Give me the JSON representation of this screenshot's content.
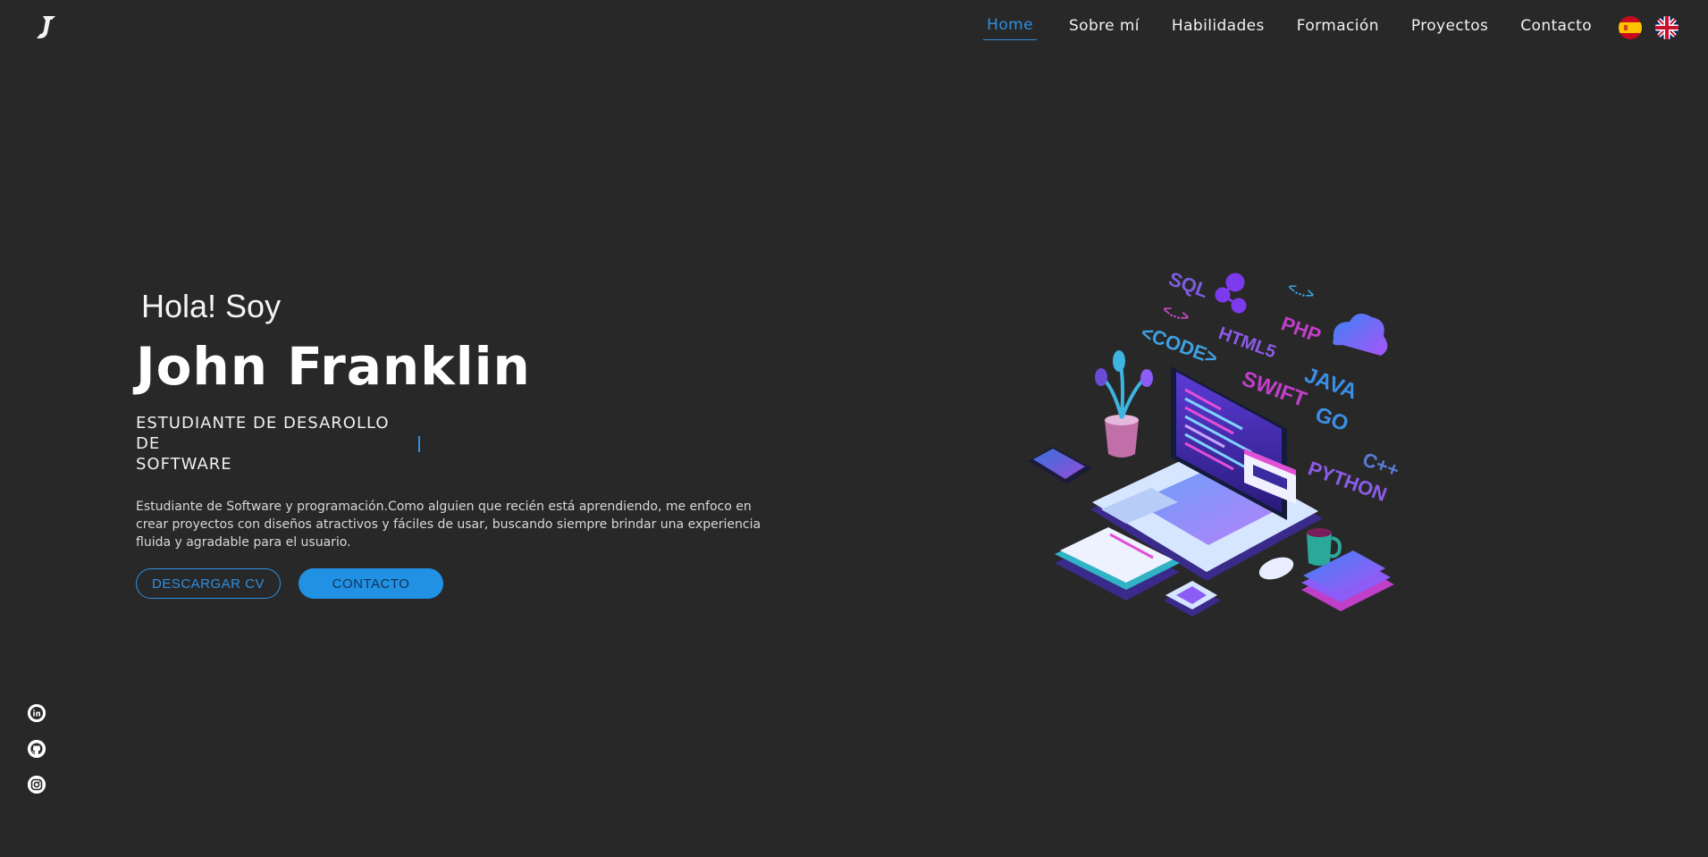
{
  "logo": {
    "letter": "J"
  },
  "nav": {
    "items": [
      {
        "label": "Home",
        "active": true
      },
      {
        "label": "Sobre mí"
      },
      {
        "label": "Habilidades"
      },
      {
        "label": "Formación"
      },
      {
        "label": "Proyectos"
      },
      {
        "label": "Contacto"
      }
    ]
  },
  "languages": [
    "spain-flag-icon",
    "uk-flag-icon"
  ],
  "hero": {
    "greeting": "Hola! Soy",
    "name": "John Franklin",
    "role_line1": "ESTUDIANTE DE DESAROLLO DE",
    "role_line2": "SOFTWARE",
    "description": "Estudiante de Software y programación.Como alguien que recién está aprendiendo, me enfoco en crear proyectos con diseños atractivos y fáciles de usar, buscando siempre brindar una experiencia fluida y agradable para el usuario.",
    "cv_button": "DESCARGAR CV",
    "contact_button": "CONTACTO"
  },
  "illustration": {
    "tags": [
      "SQL",
      "<...>",
      "<...>",
      "PHP",
      "<CODE>",
      "HTML5",
      "SWIFT",
      "JAVA",
      "GO",
      "C++",
      "PYTHON"
    ]
  },
  "social": [
    "linkedin-icon",
    "github-icon",
    "instagram-icon"
  ],
  "colors": {
    "background": "#282828",
    "accent": "#2f8fe0"
  }
}
